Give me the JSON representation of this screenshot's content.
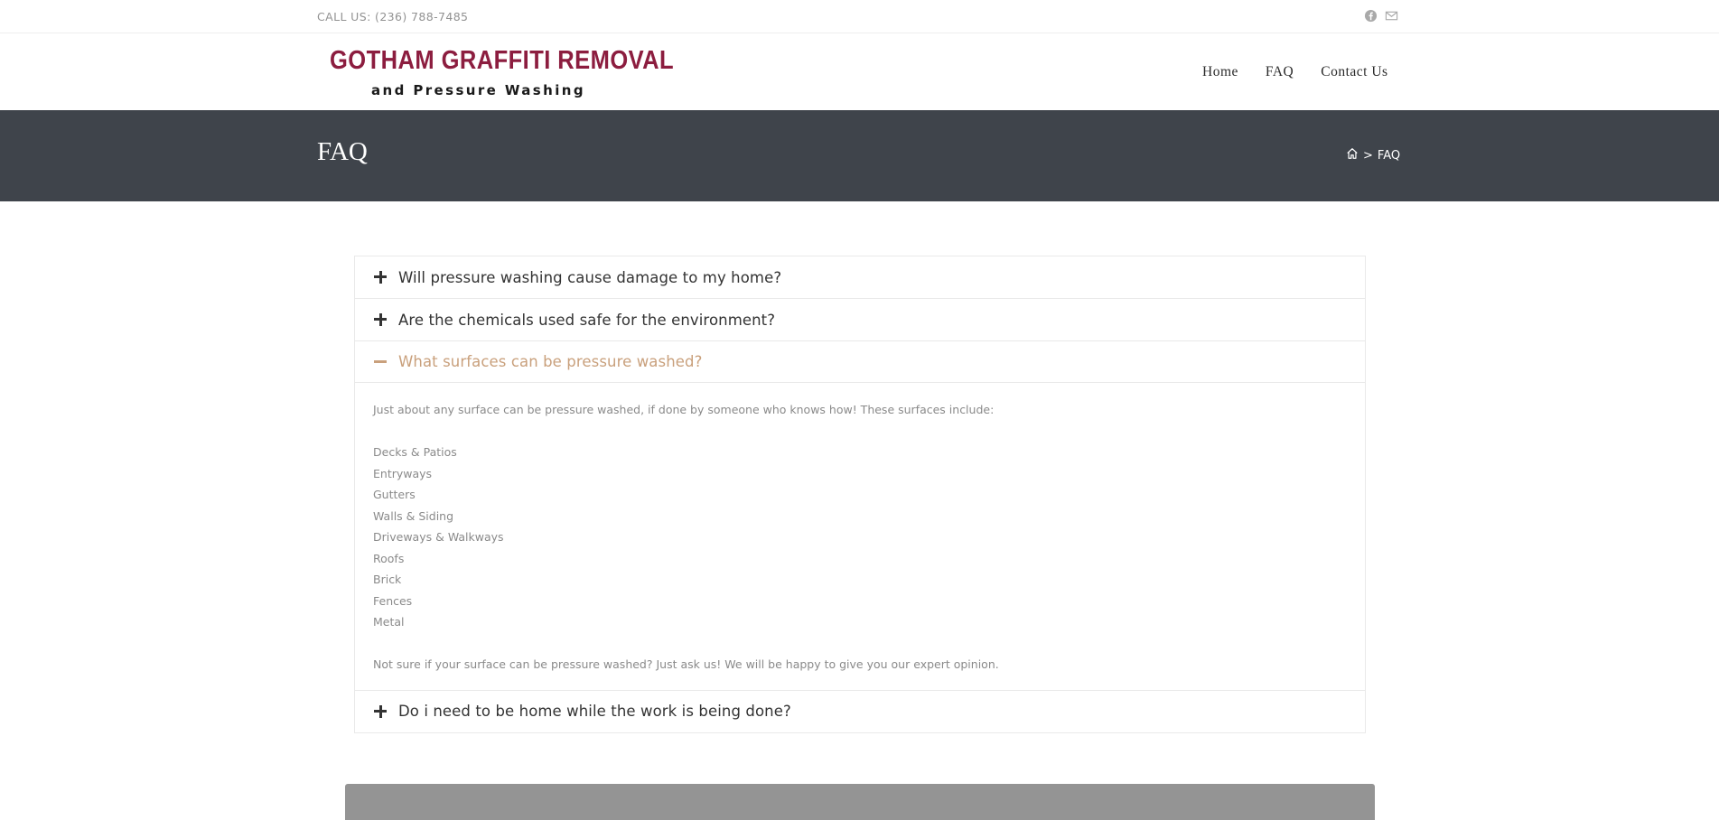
{
  "topbar": {
    "phone": "CALL US: (236) 788-7485",
    "social": [
      {
        "icon": "facebook-icon"
      },
      {
        "icon": "mail-icon"
      }
    ]
  },
  "logo": {
    "line1": "GOTHAM GRAFFITI REMOVAL",
    "line2": "and Pressure Washing",
    "brand_color": "#8c1d3f"
  },
  "nav": {
    "items": [
      "Home",
      "FAQ",
      "Contact Us"
    ]
  },
  "page_title": "FAQ",
  "breadcrumb": {
    "home_icon": "home-icon",
    "separator": ">",
    "current": "FAQ"
  },
  "faq": {
    "accent_color": "#c9a07c",
    "items": [
      {
        "question": "Will pressure washing cause damage to my home?",
        "open": false
      },
      {
        "question": "Are the chemicals used safe for the environment?",
        "open": false
      },
      {
        "question": "What surfaces can be pressure washed?",
        "open": true
      },
      {
        "question": "Do i need to be home while the work is being done?",
        "open": false
      }
    ],
    "open_answer": {
      "intro": "Just about any surface can be pressure washed, if done by someone who knows how! These surfaces include:",
      "surfaces": [
        "Decks & Patios",
        "Entryways",
        "Gutters",
        "Walls & Siding",
        "Driveways & Walkways",
        "Roofs",
        "Brick",
        "Fences",
        "Metal"
      ],
      "outro": "Not sure if your surface can be pressure washed? Just ask us! We will be happy to give you our expert opinion."
    }
  }
}
